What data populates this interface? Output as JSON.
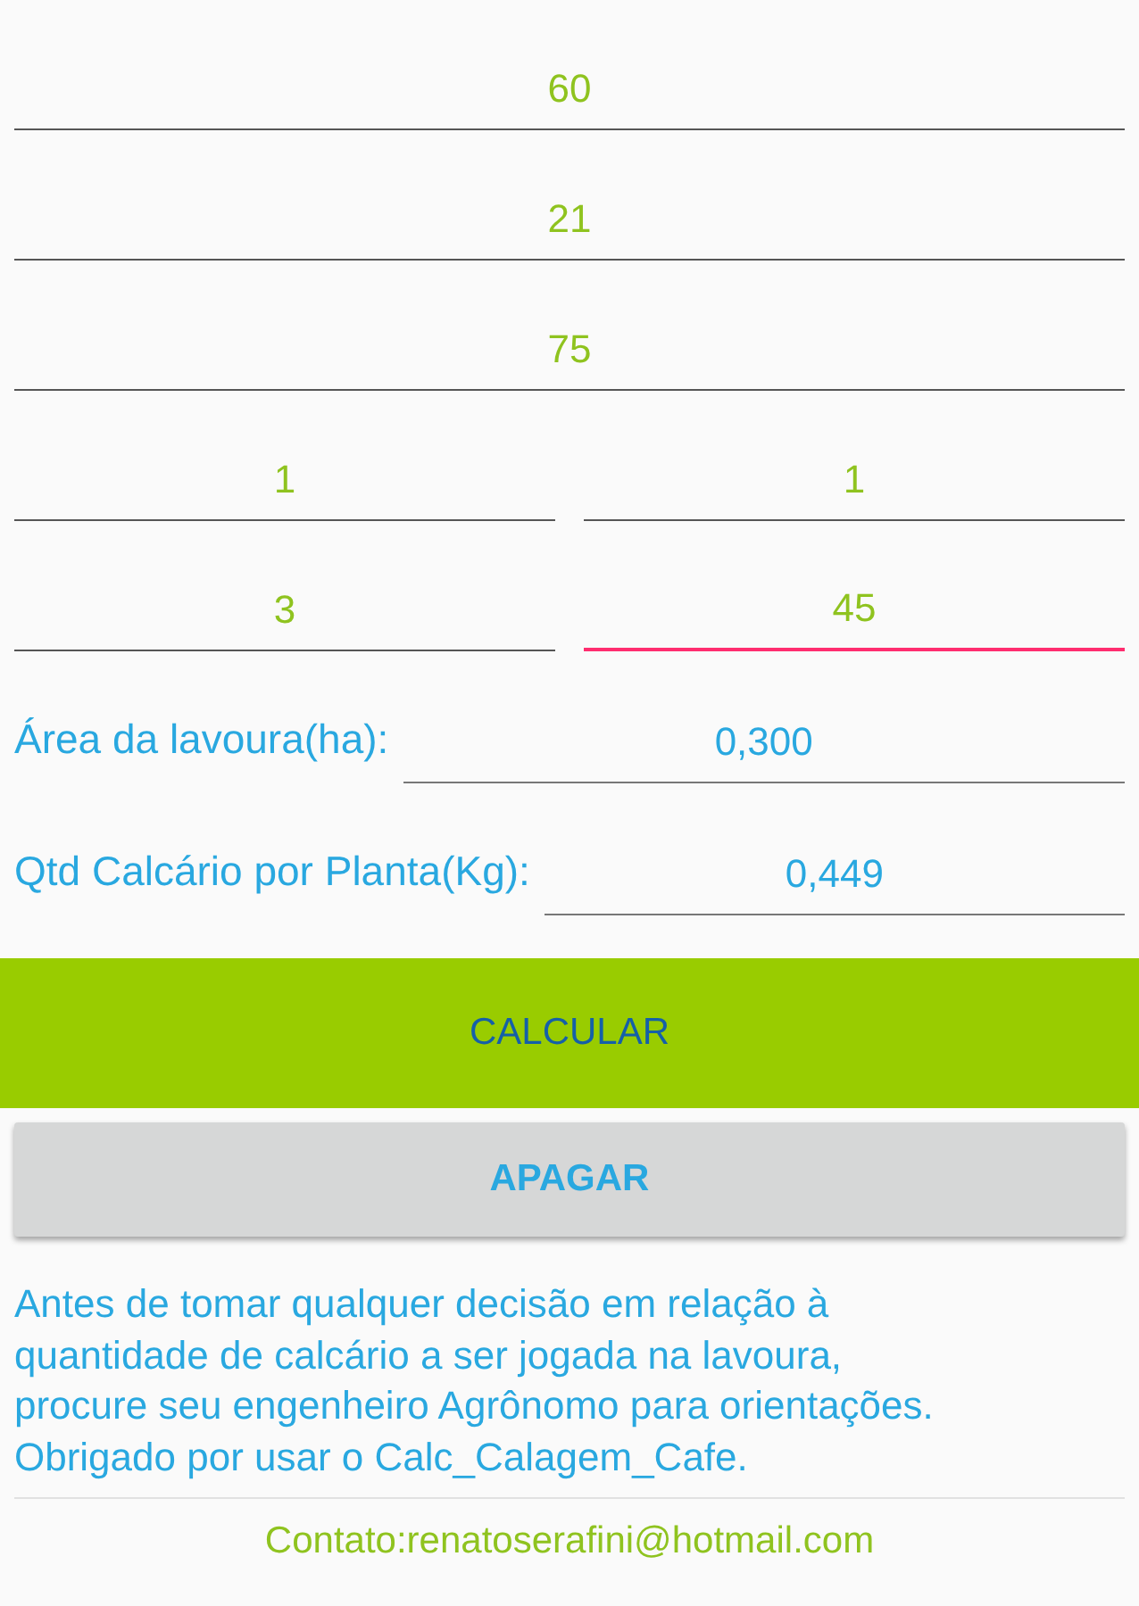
{
  "fields": [
    {
      "value": "60",
      "focused": false
    },
    {
      "value": "21",
      "focused": false
    },
    {
      "value": "75",
      "focused": false
    }
  ],
  "field_pairs": [
    [
      {
        "value": "1",
        "focused": false
      },
      {
        "value": "1",
        "focused": false
      }
    ],
    [
      {
        "value": "3",
        "focused": false
      },
      {
        "value": "45",
        "focused": true
      }
    ]
  ],
  "results": [
    {
      "label": "Área da lavoura(ha):",
      "value": "0,300"
    },
    {
      "label": "Qtd Calcário por Planta(Kg):",
      "value": "0,449"
    }
  ],
  "buttons": [
    {
      "label": "CALCULAR",
      "kind": "primary"
    },
    {
      "label": "APAGAR",
      "kind": "secondary"
    }
  ],
  "notice": "Antes de tomar qualquer decisão em relação à\nquantidade de calcário a ser jogada na lavoura,\nprocure seu engenheiro Agrônomo para orientações.\nObrigado por usar o Calc_Calagem_Cafe.",
  "contact": "Contato:renatoserafini@hotmail.com"
}
